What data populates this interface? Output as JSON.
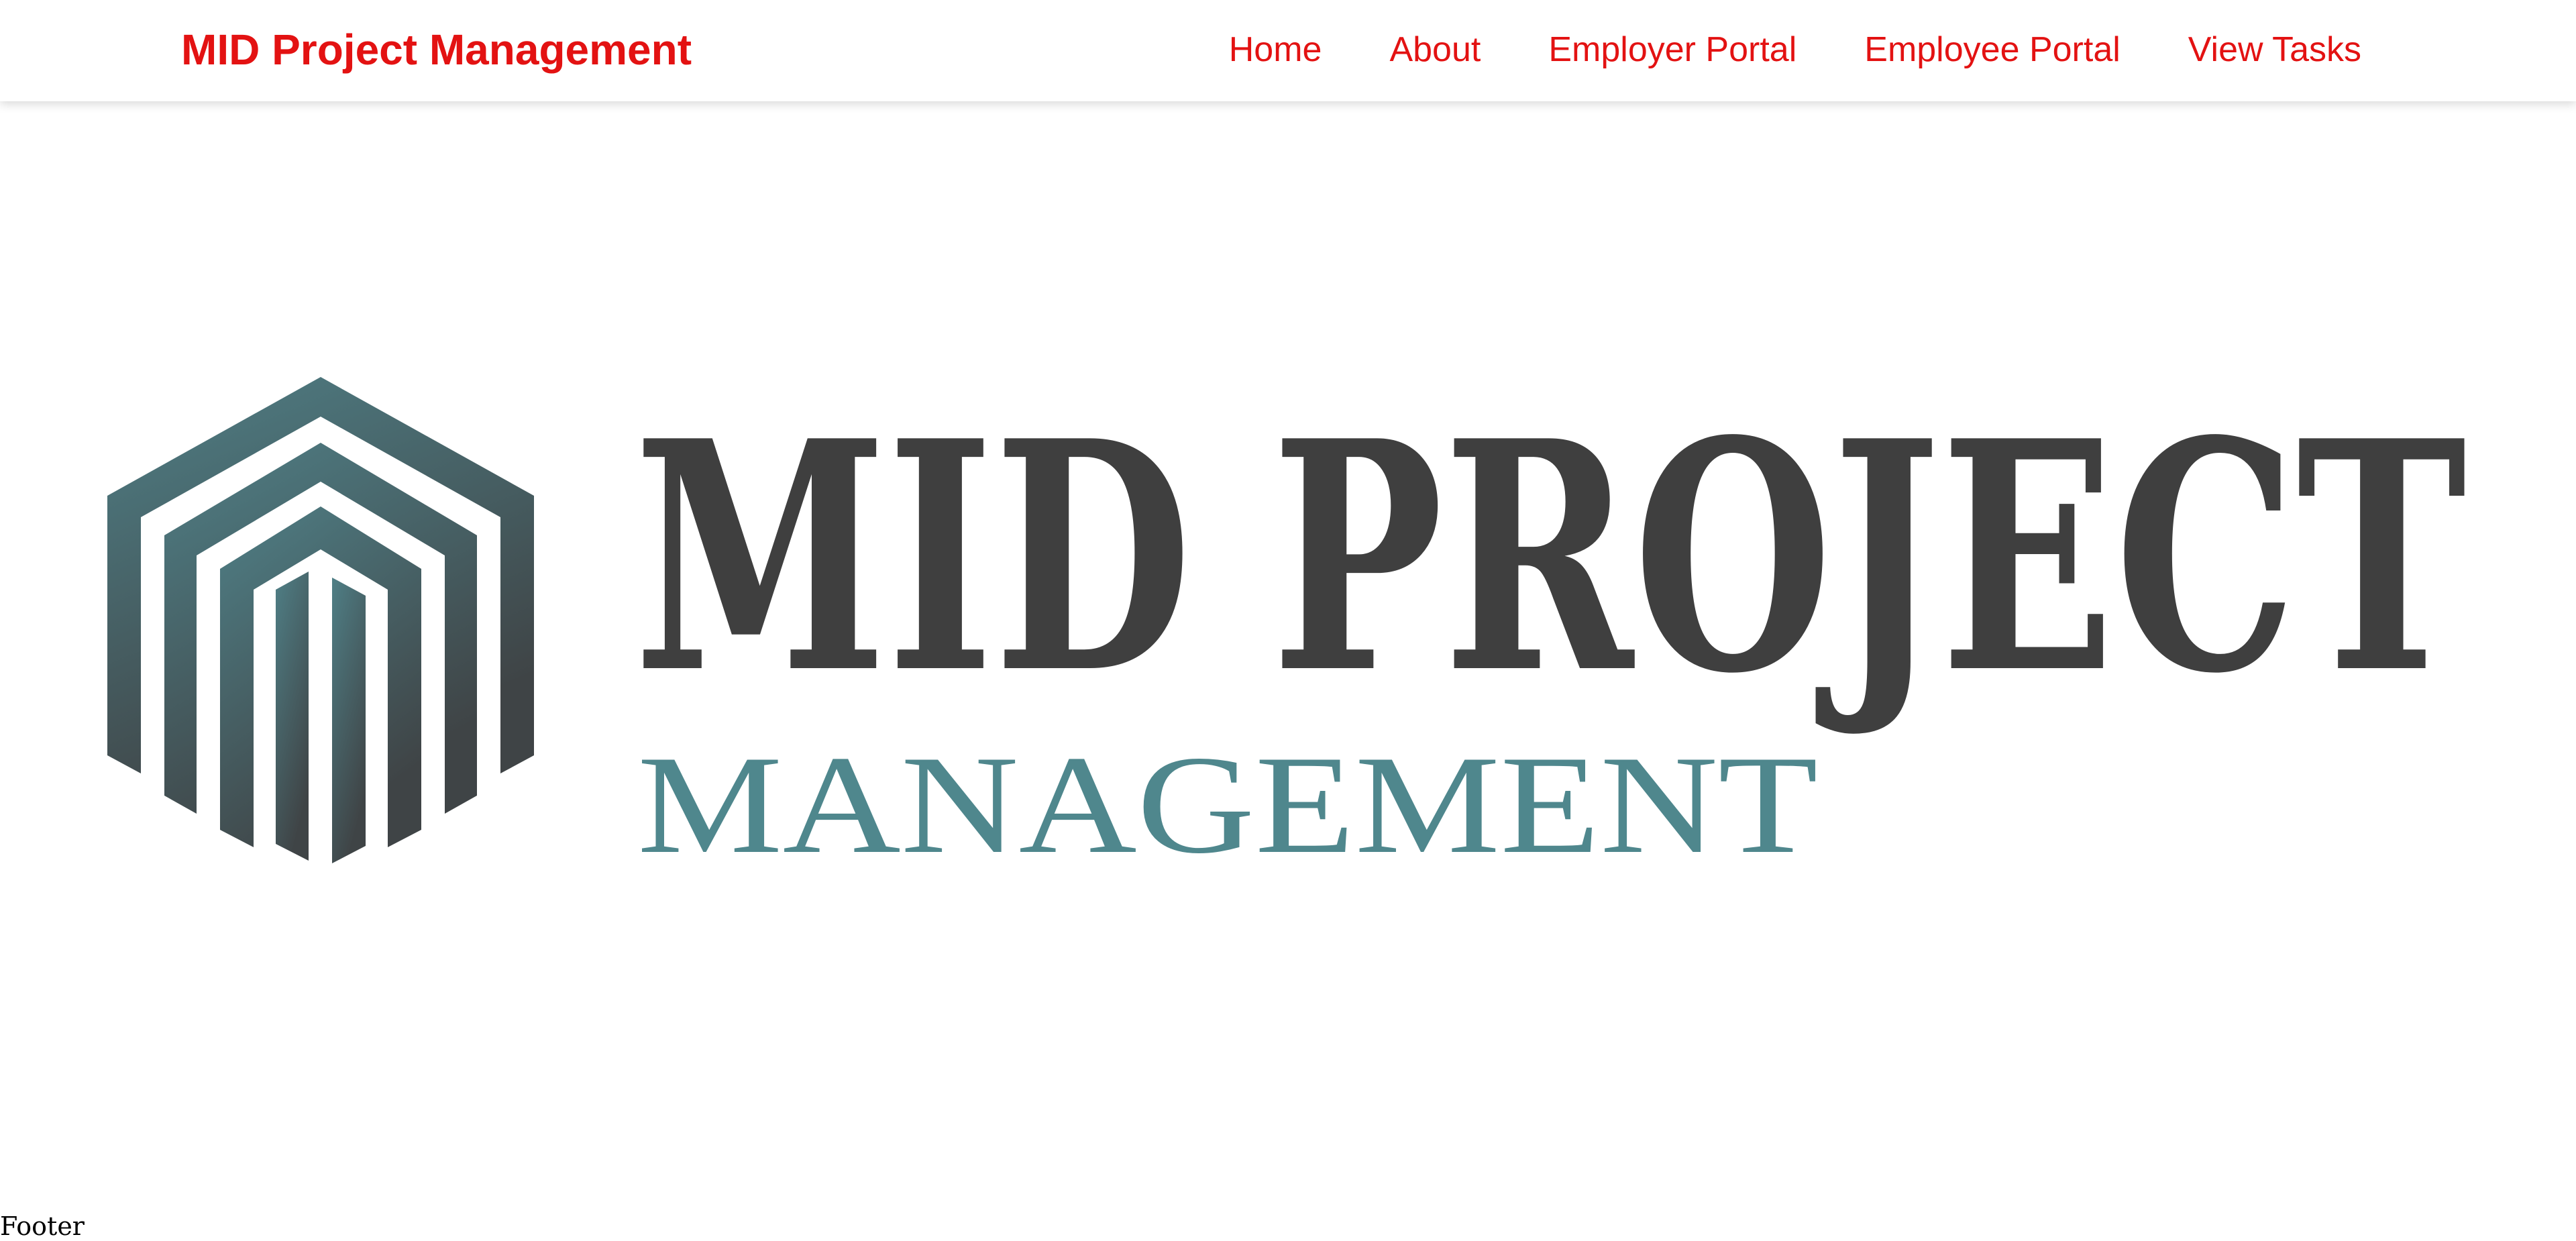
{
  "navbar": {
    "brand": "MID Project Management",
    "links": [
      {
        "label": "Home"
      },
      {
        "label": "About"
      },
      {
        "label": "Employer Portal"
      },
      {
        "label": "Employee Portal"
      },
      {
        "label": "View Tasks"
      }
    ]
  },
  "hero_logo": {
    "wordmark_top": "MID PROJECT",
    "wordmark_bottom": "MANAGEMENT",
    "icon": "hexagon-building-icon"
  },
  "footer": {
    "text": "Footer"
  },
  "colors": {
    "nav_text": "#e31212",
    "wordmark_dark": "#3f3f3f",
    "wordmark_teal": "#4f878d",
    "icon_gradient_top": "#4f7f86",
    "icon_gradient_bottom": "#3f4446"
  }
}
